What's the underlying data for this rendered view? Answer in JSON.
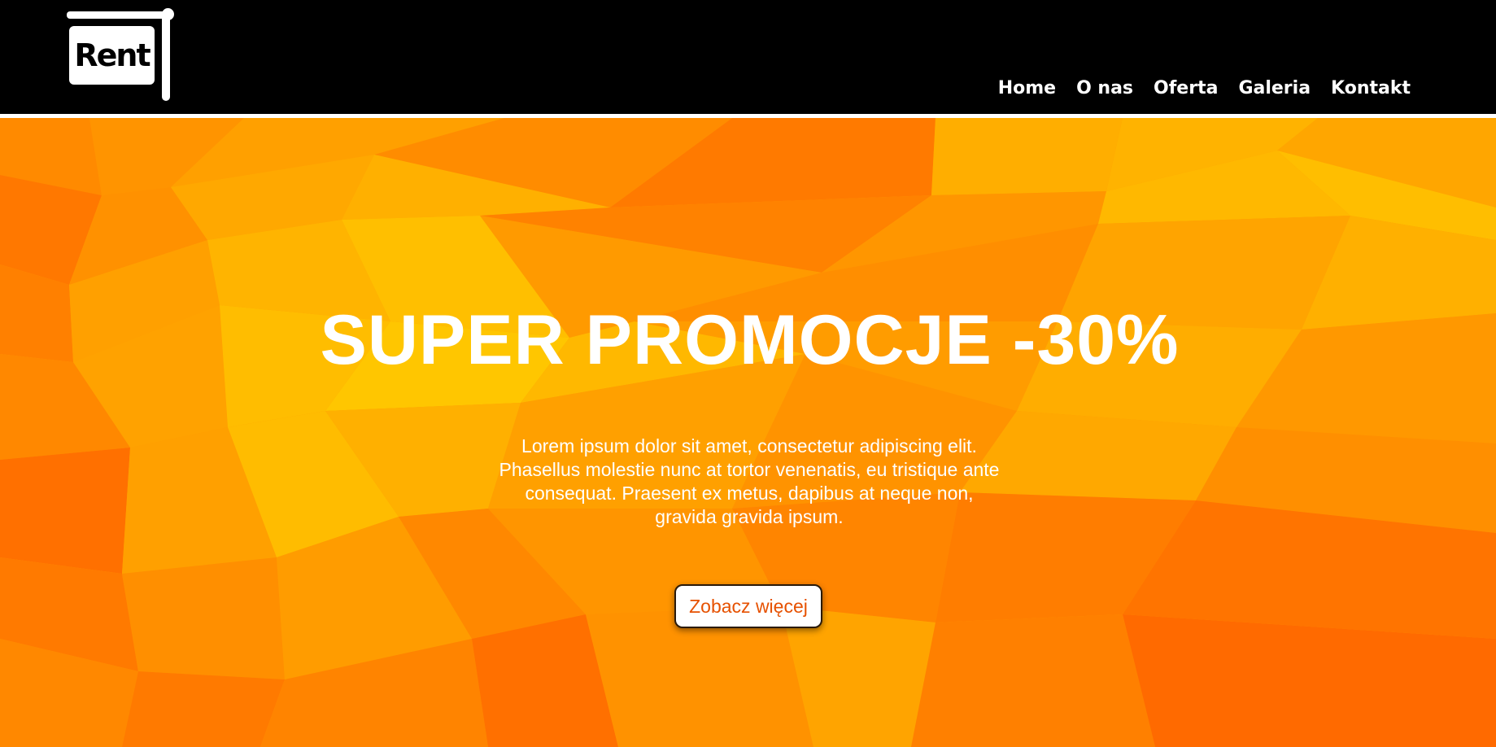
{
  "header": {
    "logo_text": "Rent",
    "nav": [
      {
        "label": "Home"
      },
      {
        "label": "O nas"
      },
      {
        "label": "Oferta"
      },
      {
        "label": "Galeria"
      },
      {
        "label": "Kontakt"
      }
    ]
  },
  "hero": {
    "title": "SUPER PROMOCJE -30%",
    "text": "Lorem ipsum dolor sit amet, consectetur adipiscing elit. Phasellus molestie nunc at tortor venenatis, eu tristique ante consequat. Praesent ex metus, dapibus at neque non, gravida gravida ipsum.",
    "button_label": "Zobacz więcej"
  },
  "colors": {
    "header_bg": "#000000",
    "hero_orange": "#ff9800",
    "hero_yellow": "#ffc107",
    "hero_deep_orange": "#ff6d00",
    "button_text": "#e65100",
    "text": "#ffffff"
  }
}
